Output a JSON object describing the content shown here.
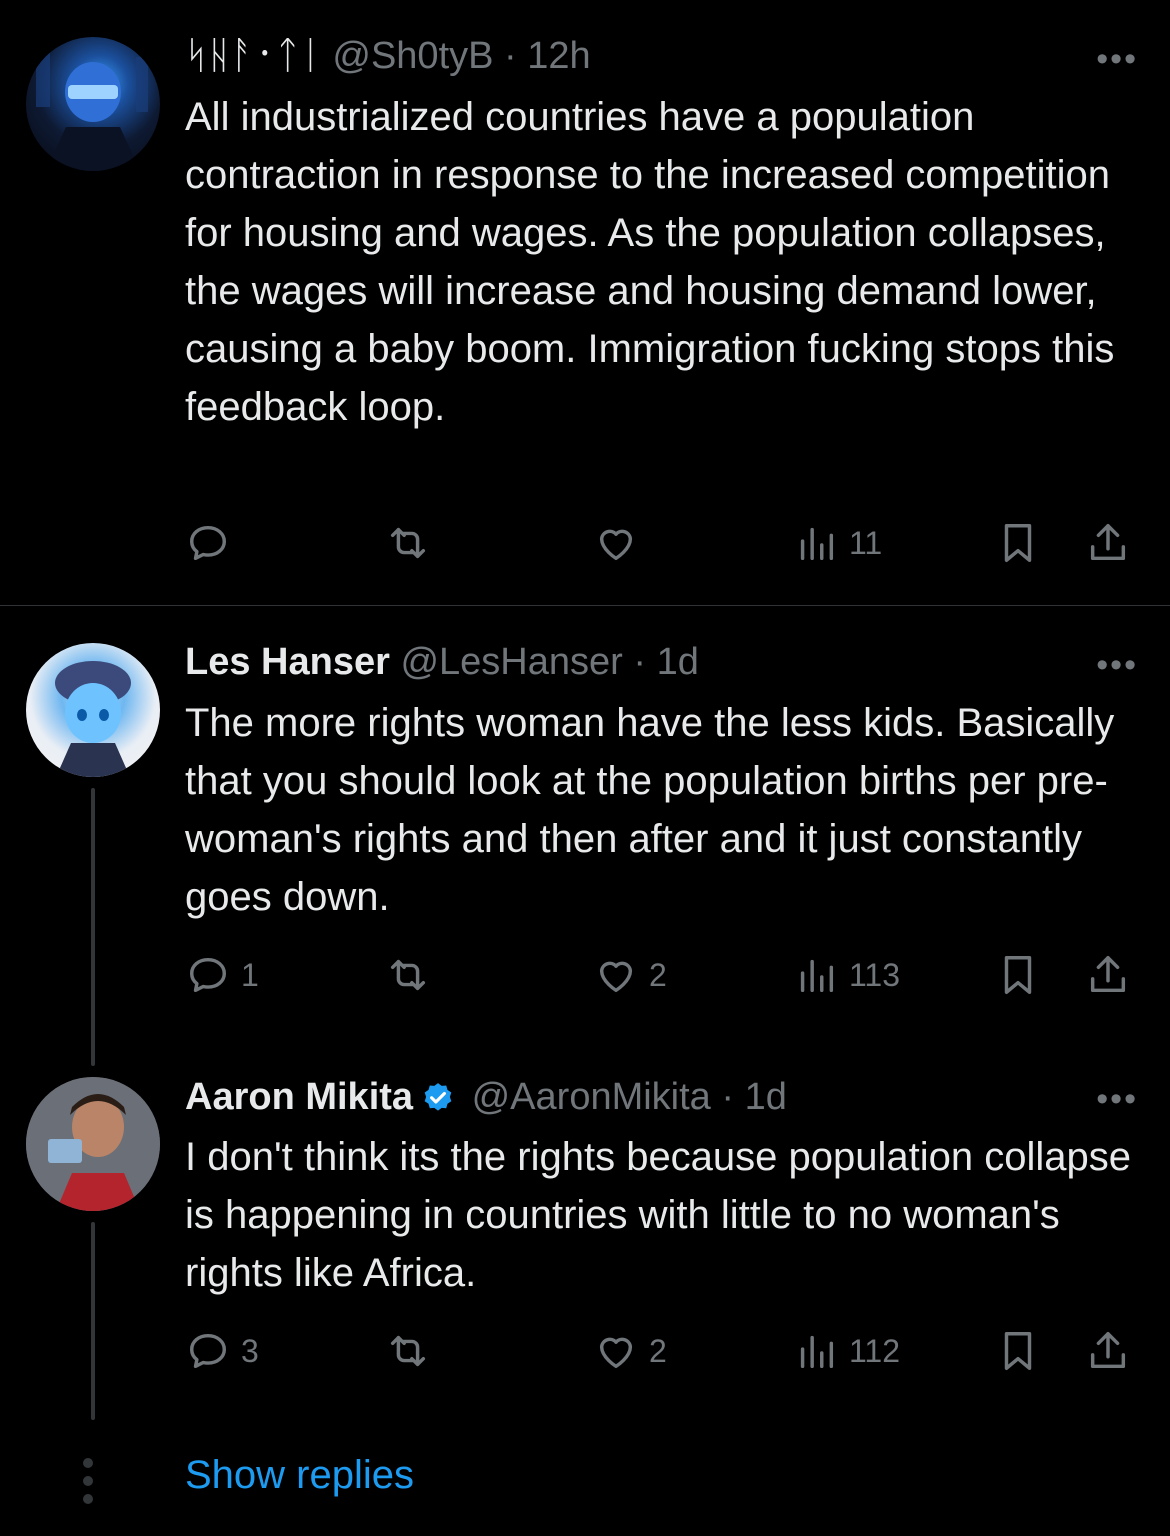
{
  "tweets": [
    {
      "display_name": "ᛋᚺᚨ᛫ᛏᛁ",
      "handle": "@Sh0tyB",
      "time": "· 12h",
      "text": "All industrialized countries have a population contraction in response to the increased competition for housing and wages. As the population collapses, the wages will increase and housing demand lower, causing a baby boom. Immigration fucking stops this feedback loop.",
      "replies": "",
      "likes": "",
      "views": "11",
      "avatar_icon": "helmet-avatar"
    },
    {
      "display_name": "Les Hanser",
      "handle": "@LesHanser",
      "time": "· 1d",
      "text": "The more rights woman have the less kids. Basically that you should look at the population births per pre-woman's rights and then after and it just constantly goes down.",
      "replies": "1",
      "likes": "2",
      "views": "113",
      "avatar_icon": "anime-avatar"
    },
    {
      "display_name": "Aaron Mikita",
      "handle": "@AaronMikita",
      "time": "· 1d",
      "text": "I don't think its the rights because population collapse is happening in countries with little to no woman's rights like Africa.",
      "replies": "3",
      "likes": "2",
      "views": "112",
      "verified": true,
      "avatar_icon": "person-photo-avatar"
    }
  ],
  "more_label": "•••",
  "show_replies": "Show replies",
  "colors": {
    "background": "#000000",
    "text": "#e7e9ea",
    "muted": "#71767b",
    "accent": "#1d9bf0",
    "divider": "#2f3336"
  }
}
